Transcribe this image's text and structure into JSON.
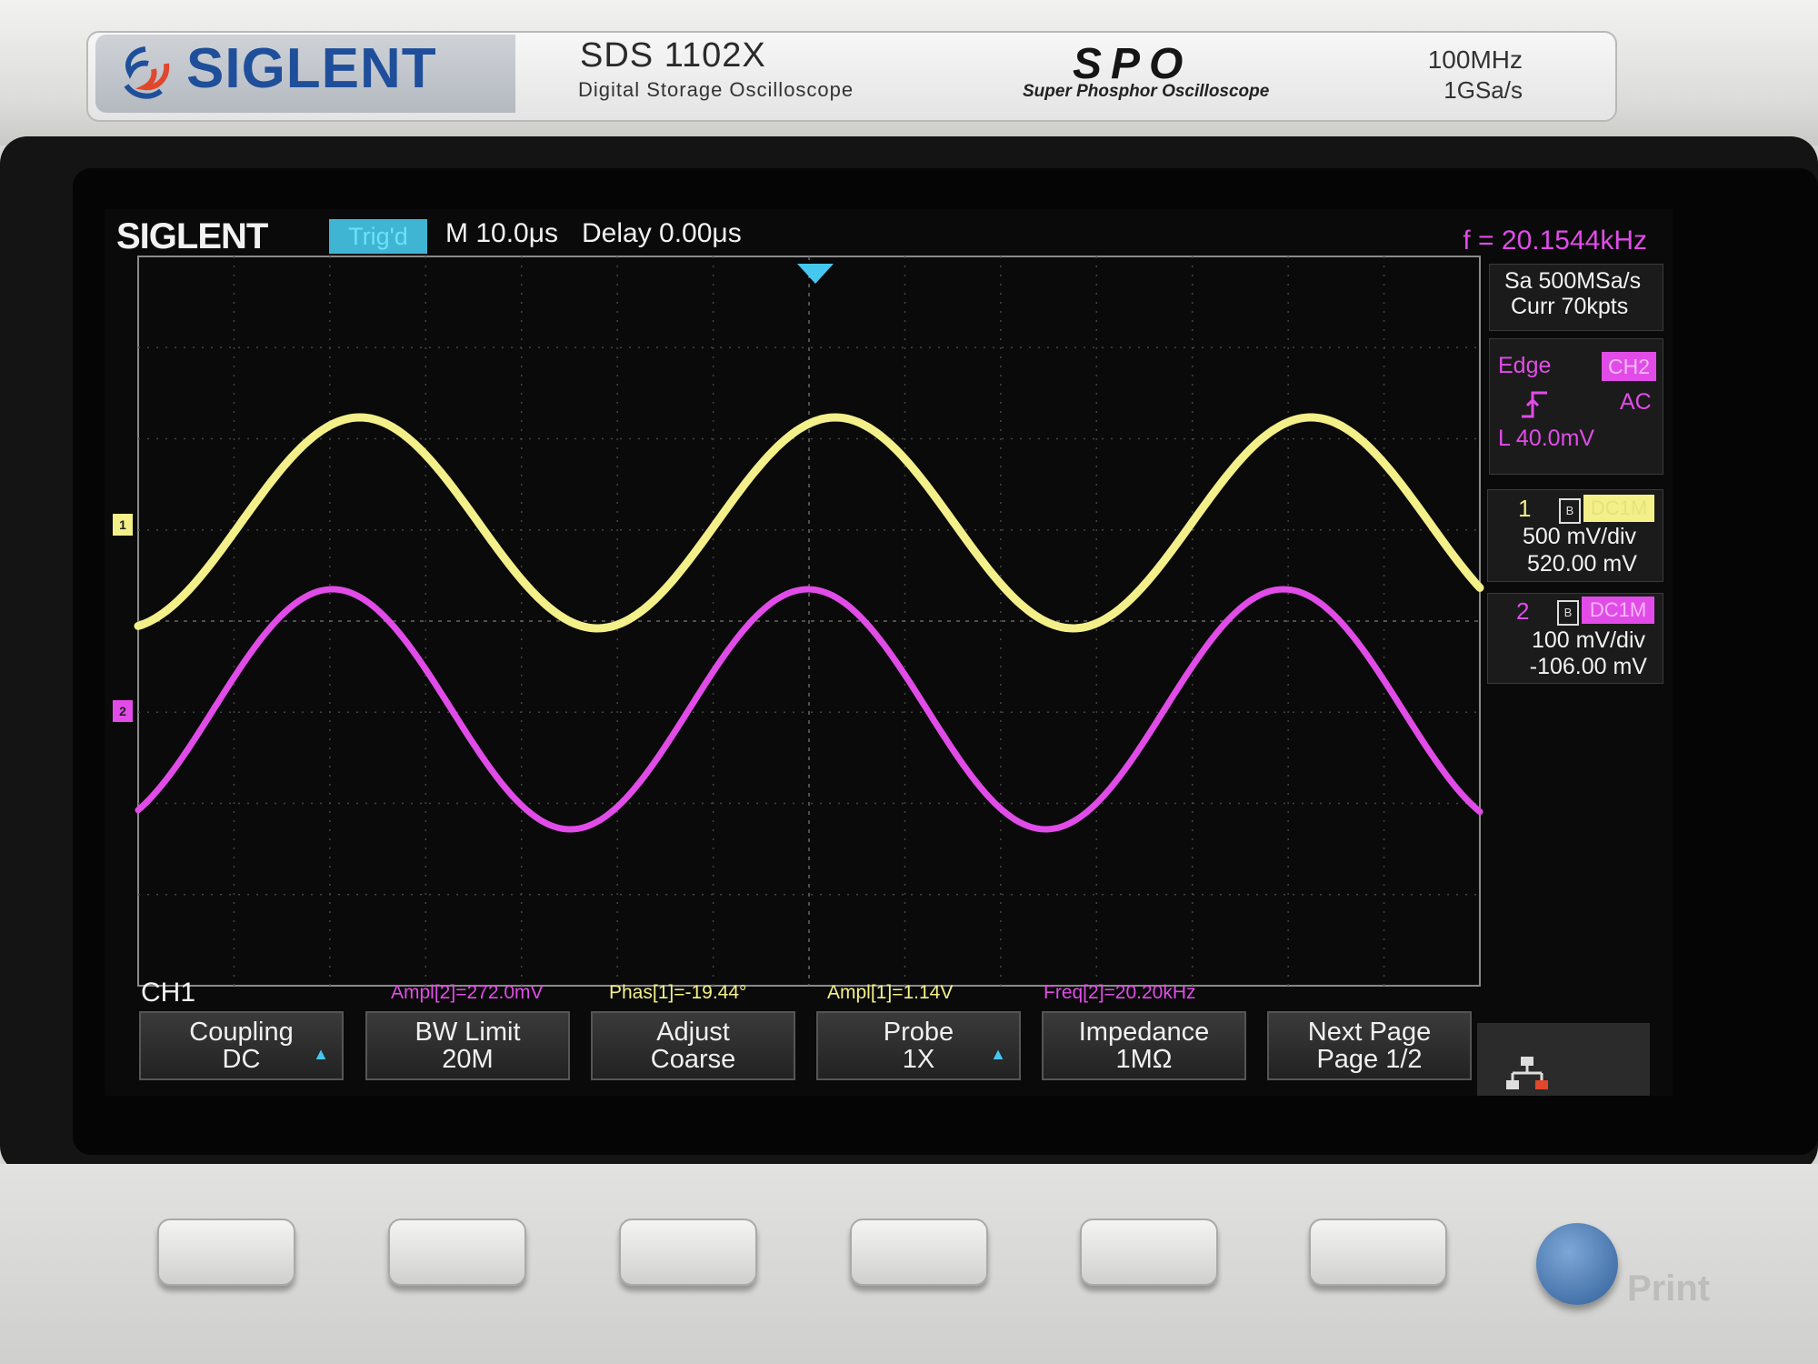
{
  "front_panel": {
    "brand": "SIGLENT",
    "model": "SDS 1102X",
    "model_description": "Digital Storage Oscilloscope",
    "technology_logo": "SPO",
    "technology_description": "Super Phosphor Oscilloscope",
    "bandwidth": "100MHz",
    "sample_rate_spec": "1GSa/s",
    "print_button_label": "Print"
  },
  "screen": {
    "logo": "SIGLENT",
    "trigger_status": "Trig'd",
    "timebase": "M 10.0μs",
    "delay": "Delay 0.00μs",
    "frequency": "f = 20.1544kHz",
    "acquisition": {
      "sample_rate": "Sa 500MSa/s",
      "memory_depth": "Curr 70kpts"
    },
    "trigger": {
      "type": "Edge",
      "source": "CH2",
      "slope_icon": "rising-edge-icon",
      "coupling": "AC",
      "level": "L  40.0mV"
    },
    "channels": [
      {
        "number": "1",
        "coupling": "DC1M",
        "scale": "500 mV/div",
        "offset": "520.00 mV",
        "color": "#f3f08a"
      },
      {
        "number": "2",
        "coupling": "DC1M",
        "scale": "100 mV/div",
        "offset": "-106.00 mV",
        "color": "#e14ce8"
      }
    ],
    "active_channel_label": "CH1",
    "measurements": [
      {
        "text": "Ampl[2]=272.0mV",
        "color": "#e14ce8"
      },
      {
        "text": "Phas[1]=-19.44°",
        "color": "#f3f08a"
      },
      {
        "text": "Ampl[1]=1.14V",
        "color": "#f3f08a"
      },
      {
        "text": "Freq[2]=20.20kHz",
        "color": "#e14ce8"
      }
    ],
    "softkeys": [
      {
        "line1": "Coupling",
        "line2": "DC",
        "arrow": true
      },
      {
        "line1": "BW Limit",
        "line2": "20M",
        "arrow": false
      },
      {
        "line1": "Adjust",
        "line2": "Coarse",
        "arrow": false
      },
      {
        "line1": "Probe",
        "line2": "1X",
        "arrow": true
      },
      {
        "line1": "Impedance",
        "line2": "1MΩ",
        "arrow": false
      },
      {
        "line1": "Next Page",
        "line2": "Page 1/2",
        "arrow": false
      }
    ],
    "waveforms": {
      "ch1": {
        "frequency_khz": 20.1544,
        "color": "#f3f08a"
      },
      "ch2": {
        "frequency_khz": 20.1544,
        "color": "#e14ce8"
      }
    }
  }
}
